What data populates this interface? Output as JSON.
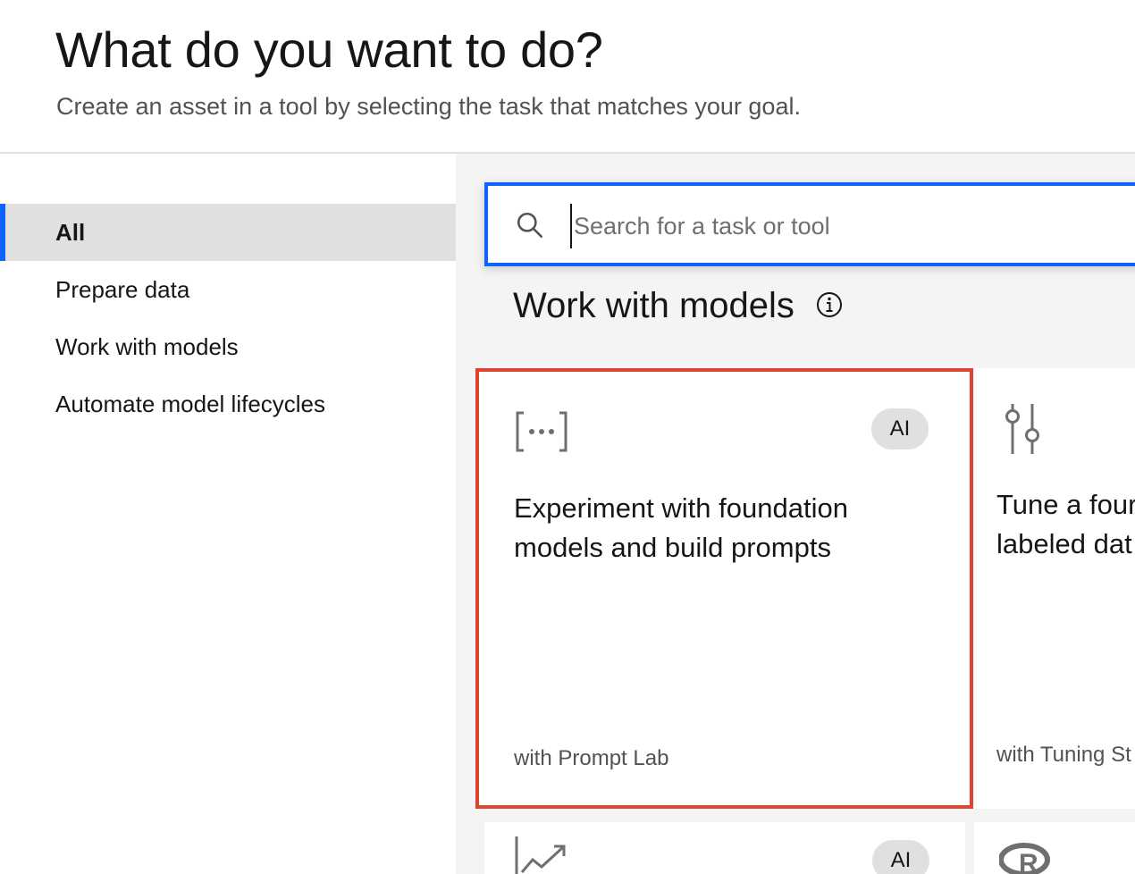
{
  "header": {
    "title": "What do you want to do?",
    "subtitle": "Create an asset in a tool by selecting the task that matches your goal."
  },
  "sidebar": {
    "items": [
      {
        "label": "All",
        "active": true
      },
      {
        "label": "Prepare data",
        "active": false
      },
      {
        "label": "Work with models",
        "active": false
      },
      {
        "label": "Automate model lifecycles",
        "active": false
      }
    ]
  },
  "search": {
    "placeholder": "Search for a task or tool",
    "value": "",
    "icon": "search-icon"
  },
  "section": {
    "title": "Work with models",
    "icon": "info-icon"
  },
  "cards": [
    {
      "icon": "prompt-brackets-icon",
      "badge": "AI",
      "title_line1": "Experiment with foundation",
      "title_line2": "models and build prompts",
      "footer": "with Prompt Lab",
      "selected": true
    },
    {
      "icon": "tuning-sliders-icon",
      "badge": "",
      "title_line1": "Tune a four",
      "title_line2": "labeled dat",
      "footer": "with Tuning St"
    },
    {
      "icon": "chart-trend-icon",
      "badge": "AI"
    },
    {
      "icon": "r-logo-icon"
    }
  ],
  "colors": {
    "accent": "#0f62fe",
    "selected_outline": "#e0432d",
    "badge_bg": "#e0e0e0",
    "main_bg": "#f4f4f4"
  }
}
